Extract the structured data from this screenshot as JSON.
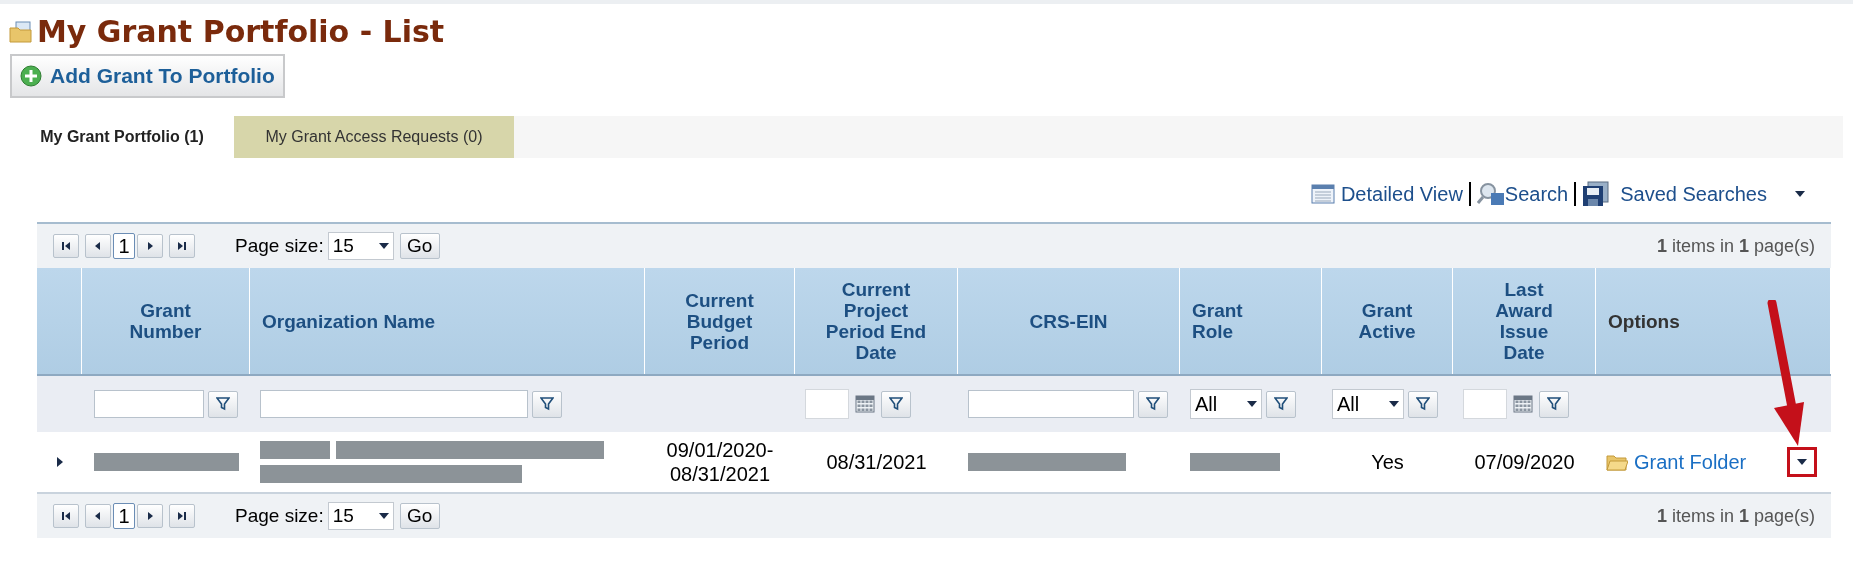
{
  "page": {
    "title": "My Grant Portfolio - List",
    "add_button": "Add Grant To Portfolio"
  },
  "tabs": [
    {
      "label": "My Grant Portfolio (1)",
      "selected": true
    },
    {
      "label": "My Grant Access Requests (0)",
      "selected": false
    }
  ],
  "toolbar": [
    "Detailed View",
    "Search",
    "Saved Searches"
  ],
  "pagers": [
    {
      "page": "1",
      "page_size_label": "Page size:",
      "page_size": "15",
      "go": "Go",
      "count": "**1** items in **1** page(s)"
    },
    {
      "page": "1",
      "page_size_label": "Page size:",
      "page_size": "15",
      "go": "Go",
      "count": "**1** items in **1** page(s)"
    }
  ],
  "table": {
    "columns": [
      "Grant Number",
      "Organization Name",
      "Current Budget Period",
      "Current Project Period End Date",
      "CRS-EIN",
      "Grant Role",
      "Grant Active",
      "Last Award Issue Date",
      "Options"
    ],
    "filters": [
      {
        "kind": "text"
      },
      {
        "kind": "text"
      },
      {
        "kind": "none"
      },
      {
        "kind": "date"
      },
      {
        "kind": "text"
      },
      {
        "kind": "select",
        "value": "All"
      },
      {
        "kind": "select",
        "value": "All"
      },
      {
        "kind": "date"
      },
      {
        "kind": "none"
      }
    ],
    "rows": [
      {
        "expanded": false,
        "cells": [
          {
            "kind": "redacted"
          },
          {
            "kind": "redacted"
          },
          {
            "kind": "text",
            "text": "09/01/2020-08/31/2021"
          },
          {
            "kind": "text",
            "text": "08/31/2021"
          },
          {
            "kind": "redacted"
          },
          {
            "kind": "redacted"
          },
          {
            "kind": "text",
            "text": "Yes"
          },
          {
            "kind": "text",
            "text": "07/09/2020"
          },
          {
            "kind": "link",
            "text": "Grant Folder"
          }
        ]
      }
    ]
  },
  "annotation": {
    "kind": "arrow"
  }
}
